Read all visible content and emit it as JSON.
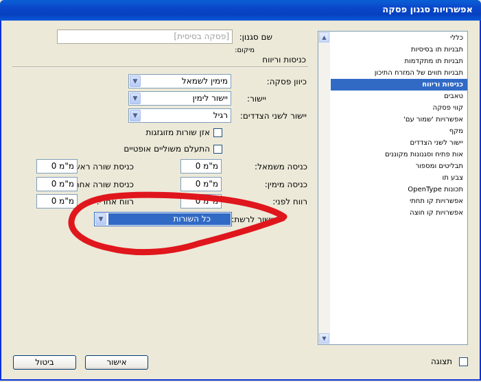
{
  "window": {
    "title": "אפשרויות סגנון פסקה"
  },
  "colors": {
    "title_bar": "#0A46C9",
    "selection": "#316AC5",
    "annotation_stroke": "#E0161D"
  },
  "style_name": {
    "label": "שם סגנון:",
    "value": "[פסקה בסיסית]"
  },
  "location_label": "מיקום:",
  "section_title": "כניסות וריווח",
  "categories": [
    "כללי",
    "תבניות תו בסיסיות",
    "תבניות תו מתקדמות",
    "תבניות תווים של המזרח התיכון",
    "כניסות וריווח",
    "טאבים",
    "קווי פסקה",
    "אפשרויות 'שמור עם'",
    "מקף",
    "יישור לשני הצדדים",
    "אות פתיח וסגנונות מקוננים",
    "תבליטים ומספור",
    "צבע תו",
    "תכונות OpenType",
    "אפשרויות קו תחתי",
    "אפשרויות קו חוצה"
  ],
  "selected_category": "כניסות וריווח",
  "paragraph_direction": {
    "label": "כיוון פסקה:",
    "value": "מימין לשמאל"
  },
  "alignment": {
    "label": "יישור:",
    "value": "יישור לימין"
  },
  "justify": {
    "label": "יישור לשני הצדדים:",
    "value": "רגיל"
  },
  "balance_ragged": {
    "label": "אזן שורות מזוגזגות",
    "checked": false
  },
  "ignore_optical": {
    "label": "התעלם משוליים אופטיים",
    "checked": false
  },
  "left_indent": {
    "label": "כניסה משמאל:",
    "value": "0 מ\"מ"
  },
  "first_line_indent": {
    "label": "כניסת שורה ראשונה:",
    "value": "0 מ\"מ"
  },
  "right_indent": {
    "label": "כניסה מימין:",
    "value": "0 מ\"מ"
  },
  "last_line_indent": {
    "label": "כניסת שורה אחרונה:",
    "value": "0 מ\"מ"
  },
  "space_before": {
    "label": "רווח לפני:",
    "value": "0 מ\"מ"
  },
  "space_after": {
    "label": "רווח אחרי:",
    "value": "0 מ\"מ"
  },
  "align_to_grid": {
    "label": "יישור לרשת:",
    "value": "כל השורות"
  },
  "preview": {
    "label": "תצוגה",
    "checked": false
  },
  "buttons": {
    "ok": "אישור",
    "cancel": "ביטול"
  },
  "icons": {
    "dropdown": "chevron-down-icon",
    "scroll_up": "scroll-up-icon",
    "scroll_down": "scroll-down-icon",
    "checkbox": "checkbox-icon"
  }
}
